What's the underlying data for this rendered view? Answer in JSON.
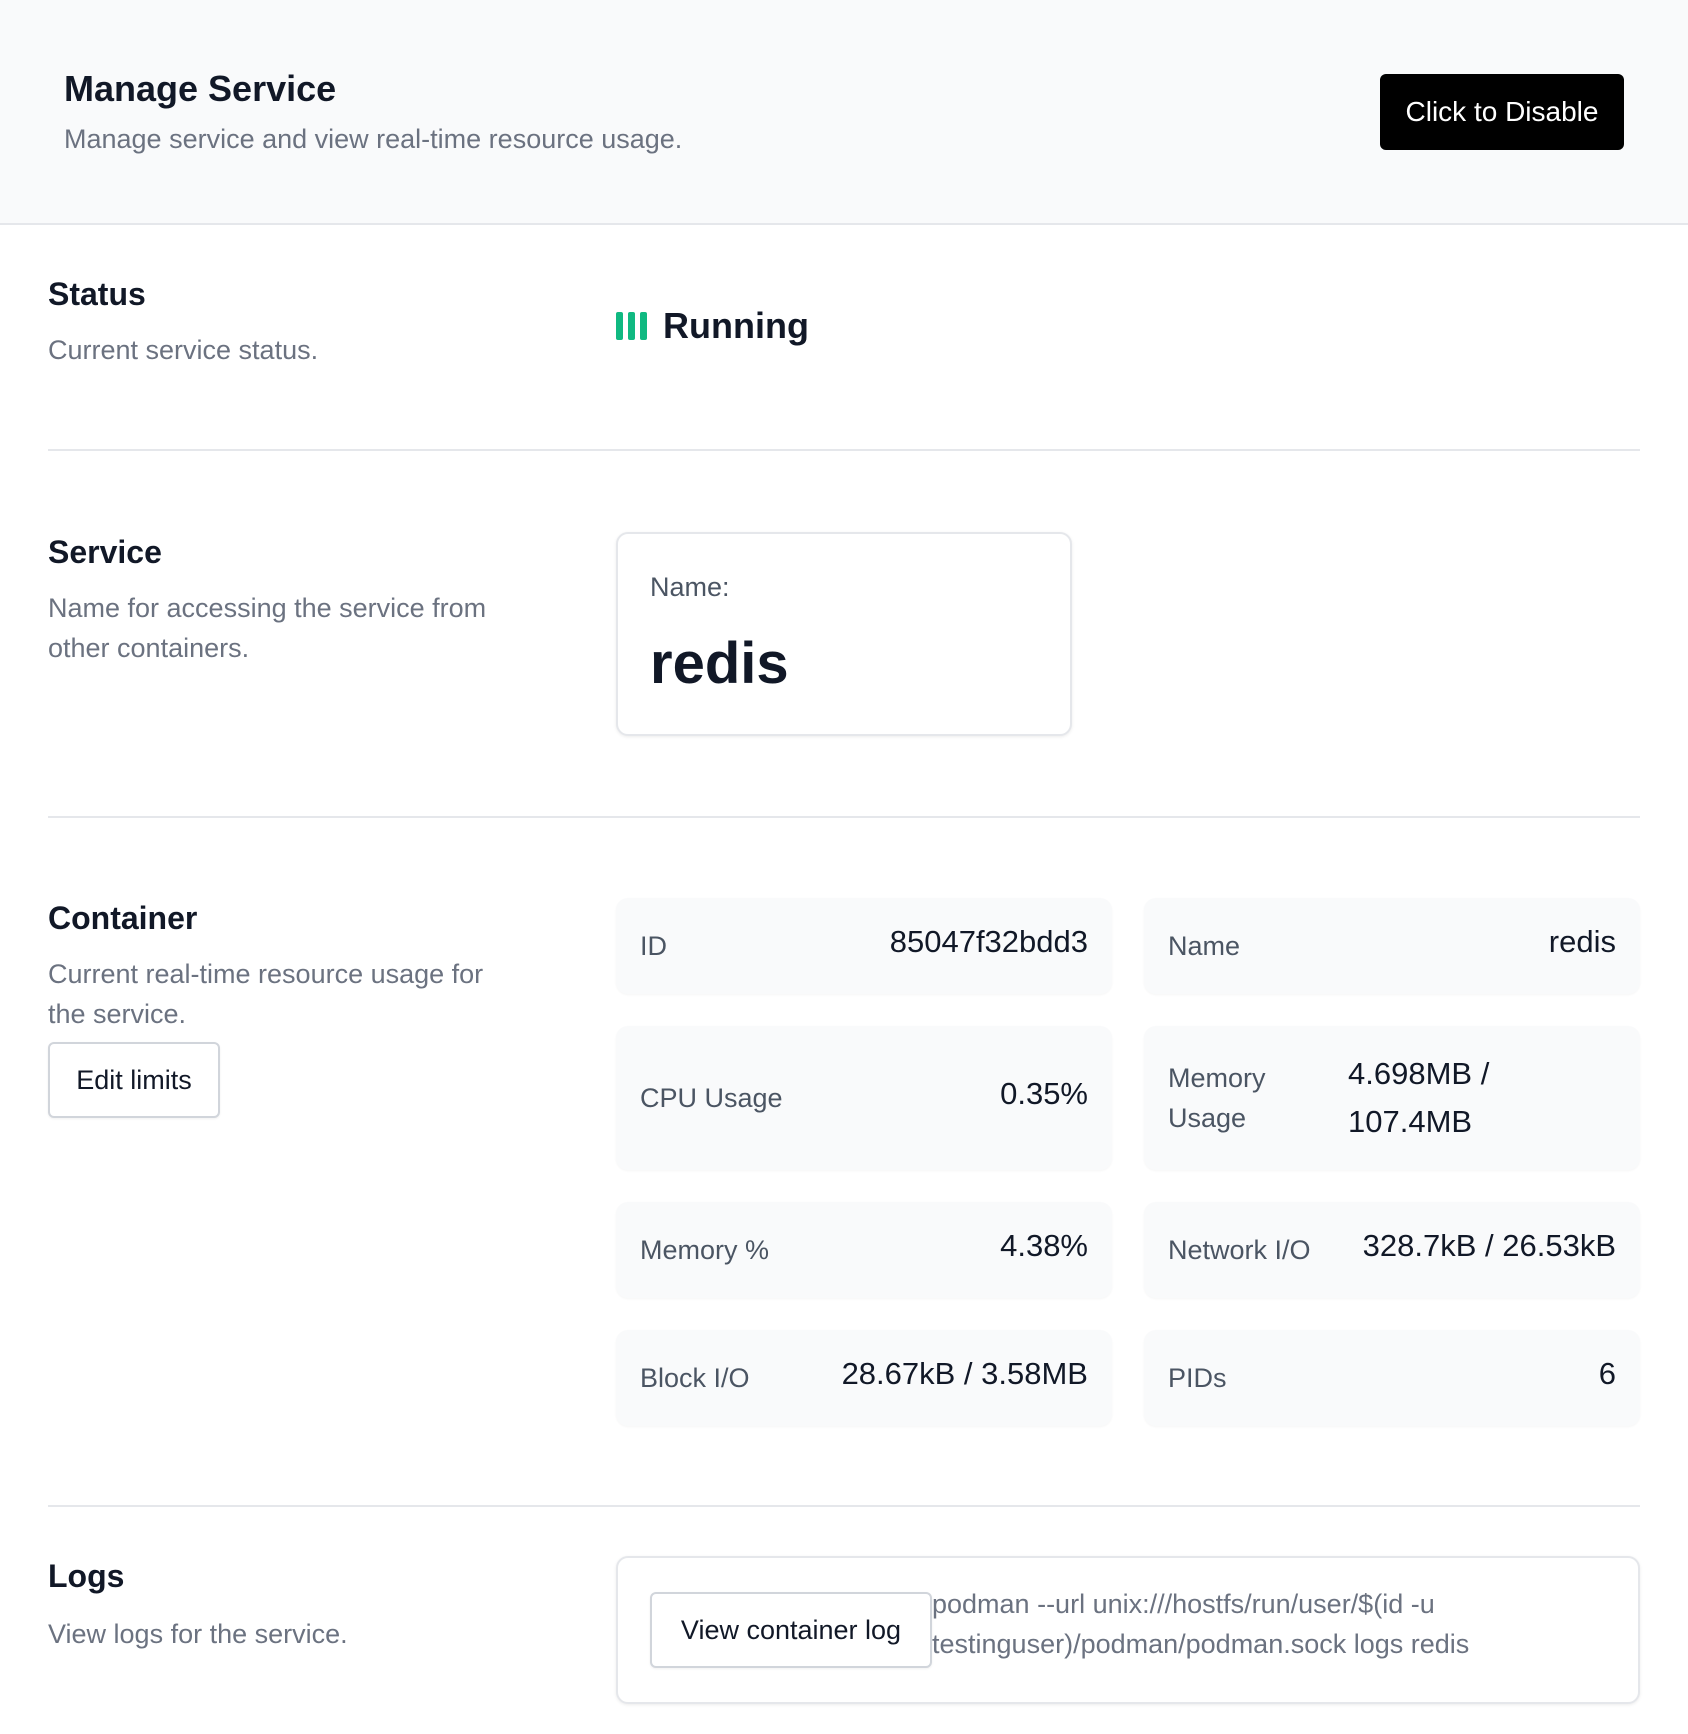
{
  "header": {
    "title": "Manage Service",
    "subtitle": "Manage service and view real-time resource usage.",
    "disable_label": "Click to Disable"
  },
  "status": {
    "title": "Status",
    "description": "Current service status.",
    "value": "Running",
    "color": "#10b981"
  },
  "service": {
    "title": "Service",
    "description": "Name for accessing the service from other containers.",
    "name_label": "Name:",
    "name_value": "redis"
  },
  "container": {
    "title": "Container",
    "description": "Current real-time resource usage for the service.",
    "edit_label": "Edit limits",
    "stats": [
      {
        "label": "ID",
        "value": "85047f32bdd3"
      },
      {
        "label": "Name",
        "value": "redis"
      },
      {
        "label": "CPU Usage",
        "value": "0.35%"
      },
      {
        "label": "Memory Usage",
        "value": "4.698MB / 107.4MB"
      },
      {
        "label": "Memory %",
        "value": "4.38%"
      },
      {
        "label": "Network I/O",
        "value": "328.7kB / 26.53kB"
      },
      {
        "label": "Block I/O",
        "value": "28.67kB / 3.58MB"
      },
      {
        "label": "PIDs",
        "value": "6"
      }
    ]
  },
  "logs": {
    "title": "Logs",
    "description": "View logs for the service.",
    "button_label": "View container log",
    "command": "podman --url unix:///hostfs/run/user/$(id -u testinguser)/podman/podman.sock logs redis"
  }
}
